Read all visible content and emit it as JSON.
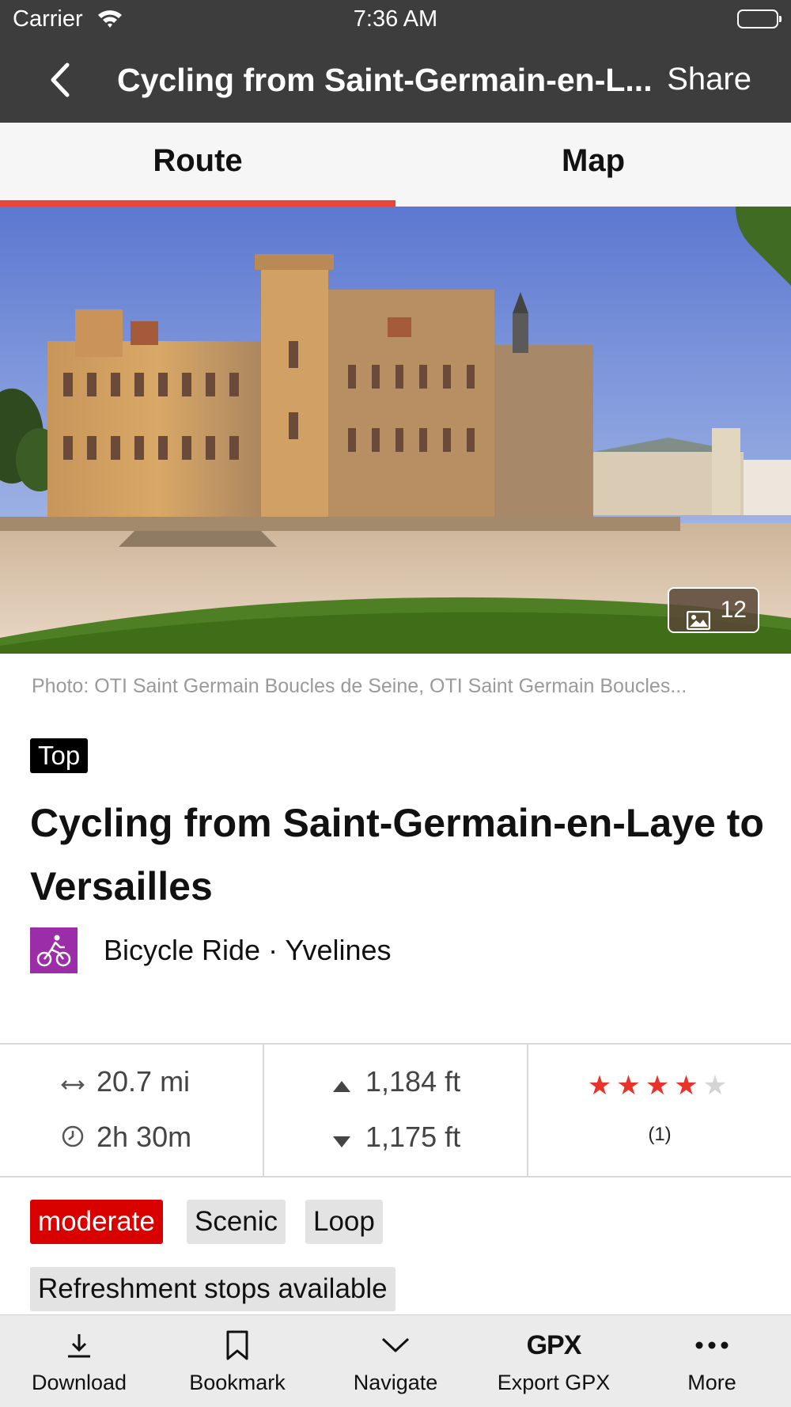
{
  "status_bar": {
    "carrier": "Carrier",
    "time": "7:36 AM"
  },
  "nav": {
    "title": "Cycling from Saint-Germain-en-L...",
    "share": "Share",
    "back_icon": "chevron-left-icon"
  },
  "tabs": [
    {
      "label": "Route",
      "selected": true
    },
    {
      "label": "Map",
      "selected": false
    }
  ],
  "hero": {
    "photo_count": "12",
    "credit": "Photo: OTI Saint Germain Boucles de Seine, OTI Saint Germain Boucles..."
  },
  "route": {
    "badge": "Top",
    "title": "Cycling from Saint-Germain-en-Laye to Versailles",
    "activity": "Bicycle Ride · Yvelines",
    "activity_color": "#9b2da8"
  },
  "stats": {
    "distance": "20.7 mi",
    "duration": "2h 30m",
    "ascent": "1,184 ft",
    "descent": "1,175 ft",
    "rating": 4,
    "rating_max": 5,
    "rating_count": "(1)"
  },
  "tags": [
    "moderate",
    "Scenic",
    "Loop",
    "Refreshment stops available"
  ],
  "toolbar": {
    "download": "Download",
    "bookmark": "Bookmark",
    "navigate": "Navigate",
    "export_icon_text": "GPX",
    "export": "Export GPX",
    "more": "More"
  },
  "colors": {
    "accent": "#e8463a",
    "difficulty_moderate": "#d90000",
    "star": "#e8322a",
    "header": "#3d3d3d"
  }
}
